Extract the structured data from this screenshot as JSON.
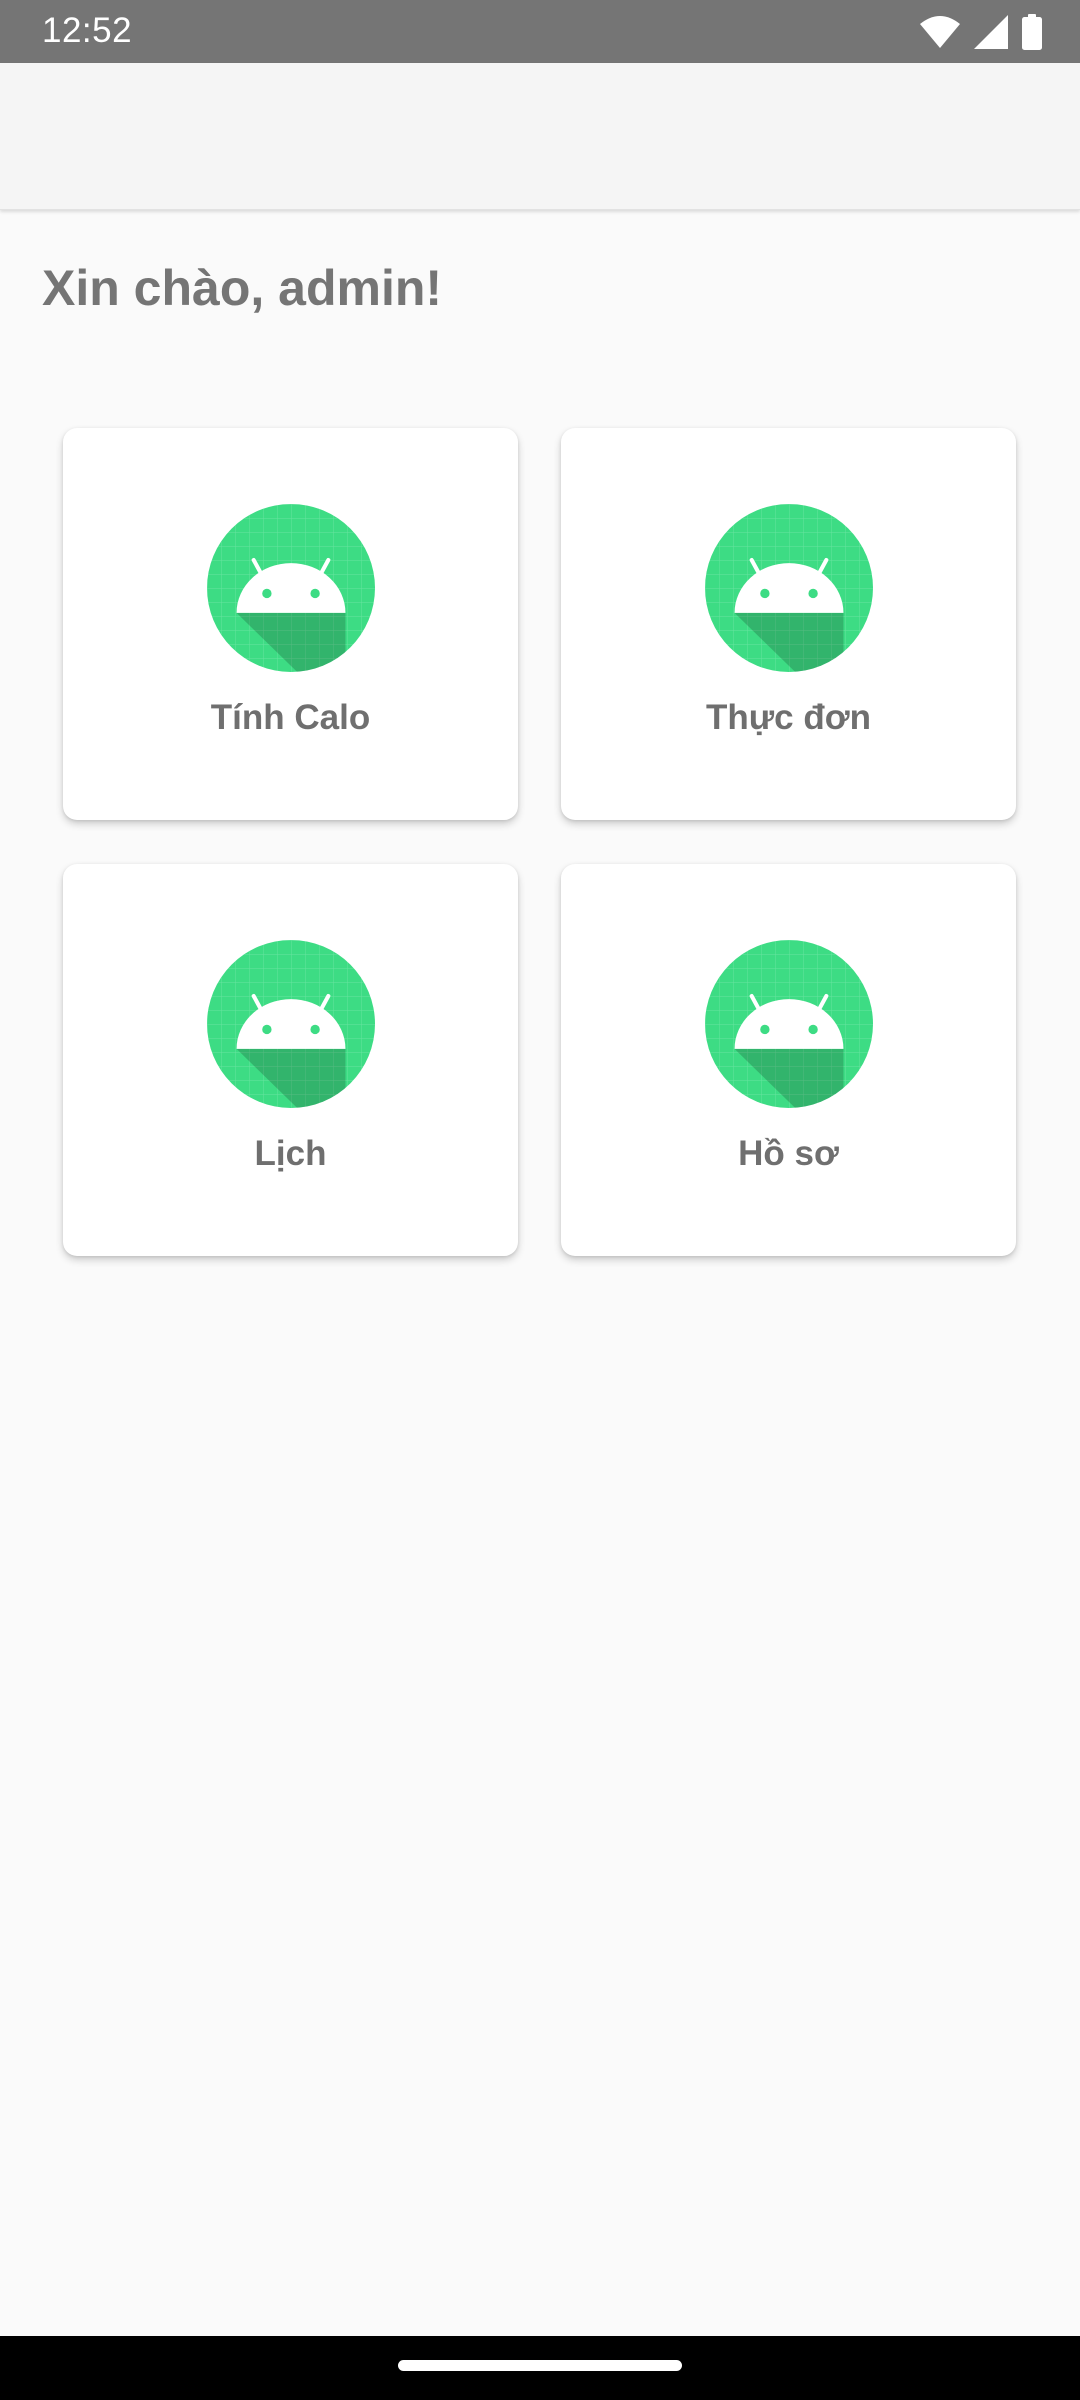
{
  "status_bar": {
    "time": "12:52",
    "icons": [
      "wifi-icon",
      "cellular-signal-icon",
      "battery-icon"
    ]
  },
  "app_bar": {
    "title": ""
  },
  "greeting": "Xin chào, admin!",
  "menu": {
    "items": [
      {
        "label": "Tính Calo",
        "icon": "android-icon"
      },
      {
        "label": "Thực đơn",
        "icon": "android-icon"
      },
      {
        "label": "Lịch",
        "icon": "android-icon"
      },
      {
        "label": "Hồ sơ",
        "icon": "android-icon"
      }
    ]
  },
  "colors": {
    "status_bar": "#757575",
    "app_bar": "#f5f5f5",
    "background": "#fafafa",
    "card": "#ffffff",
    "icon_green": "#3ddc84",
    "text_gray": "#757575",
    "nav_bar": "#000000"
  }
}
